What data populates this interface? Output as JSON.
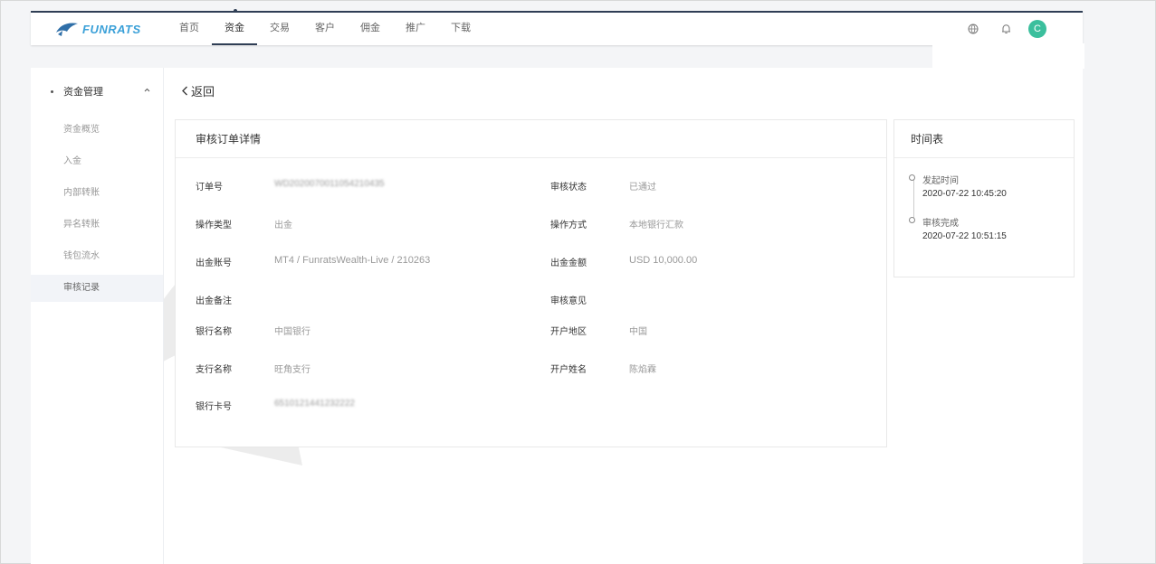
{
  "app": {
    "logo_text": "FUNRATS"
  },
  "nav": {
    "items": [
      {
        "label": "首页"
      },
      {
        "label": "资金",
        "active": true
      },
      {
        "label": "交易"
      },
      {
        "label": "客户"
      },
      {
        "label": "佣金"
      },
      {
        "label": "推广"
      },
      {
        "label": "下载"
      }
    ]
  },
  "user": {
    "avatar_letter": "C"
  },
  "sidebar": {
    "section": "资金管理",
    "items": [
      {
        "label": "资金概览"
      },
      {
        "label": "入金"
      },
      {
        "label": "内部转账"
      },
      {
        "label": "异名转账"
      },
      {
        "label": "钱包流水"
      },
      {
        "label": "审核记录",
        "active": true
      }
    ]
  },
  "back_label": "返回",
  "detail": {
    "title": "审核订单详情",
    "order_no_label": "订单号",
    "order_no": "WD2020070011054210435",
    "status_label": "审核状态",
    "status": "已通过",
    "op_type_label": "操作类型",
    "op_type": "出金",
    "method_label": "操作方式",
    "method": "本地银行汇款",
    "account_label": "出金账号",
    "account": "MT4 / FunratsWealth-Live / 210263",
    "amount_label": "出金金额",
    "amount": "USD 10,000.00",
    "remark_label": "出金备注",
    "remark": "",
    "opinion_label": "审核意见",
    "opinion": "",
    "bank_label": "银行名称",
    "bank": "中国银行",
    "region_label": "开户地区",
    "region": "中国",
    "branch_label": "支行名称",
    "branch": "旺角支行",
    "holder_label": "开户姓名",
    "holder": "陈焰霖",
    "card_label": "银行卡号",
    "card": "6510121441232222"
  },
  "timeline": {
    "title": "时间表",
    "items": [
      {
        "label": "发起时间",
        "time": "2020-07-22 10:45:20"
      },
      {
        "label": "审核完成",
        "time": "2020-07-22  10:51:15"
      }
    ]
  },
  "colors": {
    "nav_accent": "#2f3e55",
    "logo_blue": "#3aa0d8",
    "avatar": "#3bbf9d"
  }
}
